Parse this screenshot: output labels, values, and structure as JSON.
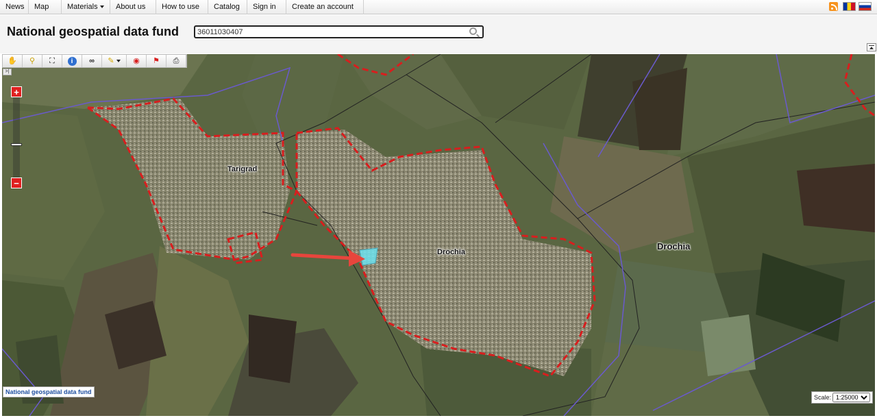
{
  "nav": {
    "items": [
      "News",
      "Map",
      "Materials",
      "About us",
      "How to use",
      "Catalog",
      "Sign in",
      "Create an account"
    ],
    "languages": [
      "ro",
      "ru"
    ]
  },
  "header": {
    "title": "National geospatial data fund",
    "search_value": "36011030407"
  },
  "toolbar": {
    "tools": [
      "pan-icon",
      "identify-search-icon",
      "full-extent-icon",
      "info-icon",
      "binoculars-icon",
      "measure-icon",
      "target-icon",
      "flag-icon",
      "print-icon"
    ]
  },
  "map": {
    "labels": {
      "tarigrad": "Tarigrad",
      "drochia_town": "Drochia",
      "drochia_district": "Drochia"
    },
    "attribution": "National geospatial data fund",
    "scale_label": "Scale:",
    "scale_value": "1:25000",
    "zoom_in": "+",
    "zoom_out": "−",
    "colors": {
      "locality_boundary": "#d81e1e",
      "admin_boundary": "#6a5acd",
      "cadastral_boundary": "#222222",
      "highlighted_parcel": "#6ee3f0",
      "arrow": "#e8453c"
    }
  }
}
